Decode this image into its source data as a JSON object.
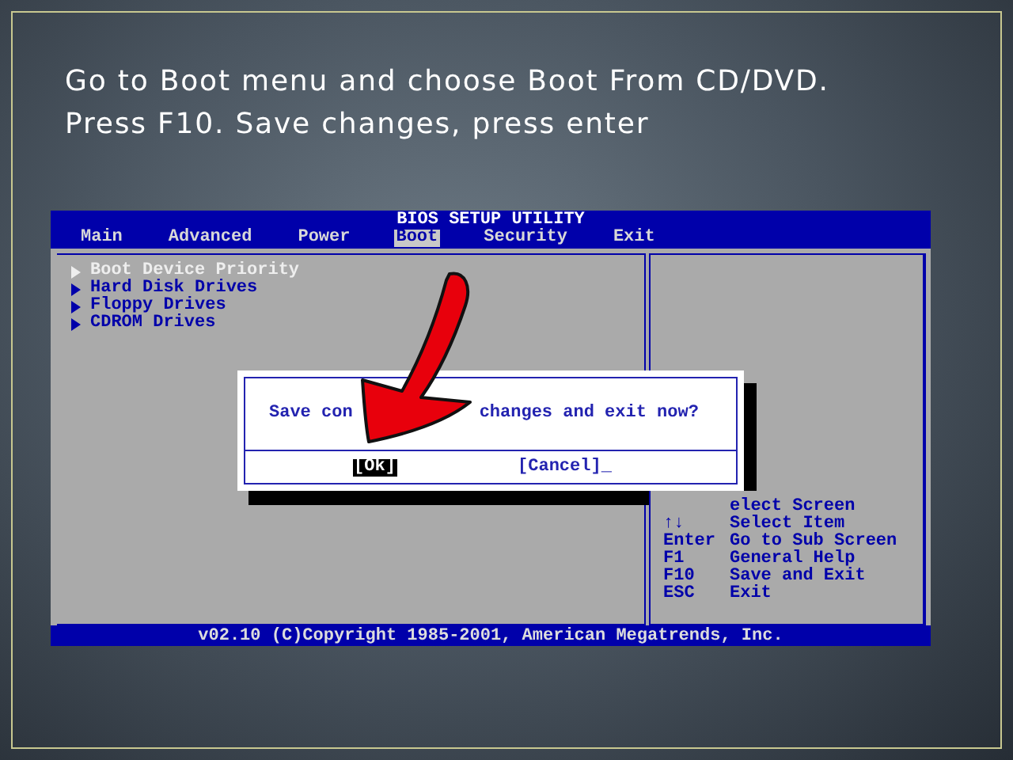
{
  "slide": {
    "title_lines": [
      "Go to Boot menu and choose Boot From CD/DVD.",
      "Press F10. Save changes, press enter"
    ]
  },
  "bios": {
    "title": "BIOS SETUP UTILITY",
    "tabs": [
      {
        "label": "Main",
        "selected": false
      },
      {
        "label": "Advanced",
        "selected": false
      },
      {
        "label": "Power",
        "selected": false
      },
      {
        "label": "Boot",
        "selected": true
      },
      {
        "label": "Security",
        "selected": false
      },
      {
        "label": "Exit",
        "selected": false
      }
    ],
    "items": [
      {
        "label": "Boot Device Priority",
        "selected": true
      },
      {
        "label": "Hard Disk Drives",
        "selected": false
      },
      {
        "label": "Floppy Drives",
        "selected": false
      },
      {
        "label": "CDROM Drives",
        "selected": false
      }
    ],
    "help": [
      {
        "action": "elect Screen"
      },
      {
        "key": "↑↓",
        "action": "Select Item"
      },
      {
        "key": "Enter",
        "action": "Go to Sub Screen"
      },
      {
        "key": "F1",
        "action": "General Help"
      },
      {
        "key": "F10",
        "action": "Save and Exit"
      },
      {
        "key": "ESC",
        "action": "Exit"
      }
    ],
    "footer": "v02.10 (C)Copyright 1985-2001, American Megatrends, Inc."
  },
  "dialog": {
    "message_parts": [
      "Save con",
      "changes and exit now?"
    ],
    "buttons": [
      {
        "label": "[Ok]",
        "selected": true
      },
      {
        "label": "[Cancel]_",
        "selected": false
      }
    ]
  }
}
